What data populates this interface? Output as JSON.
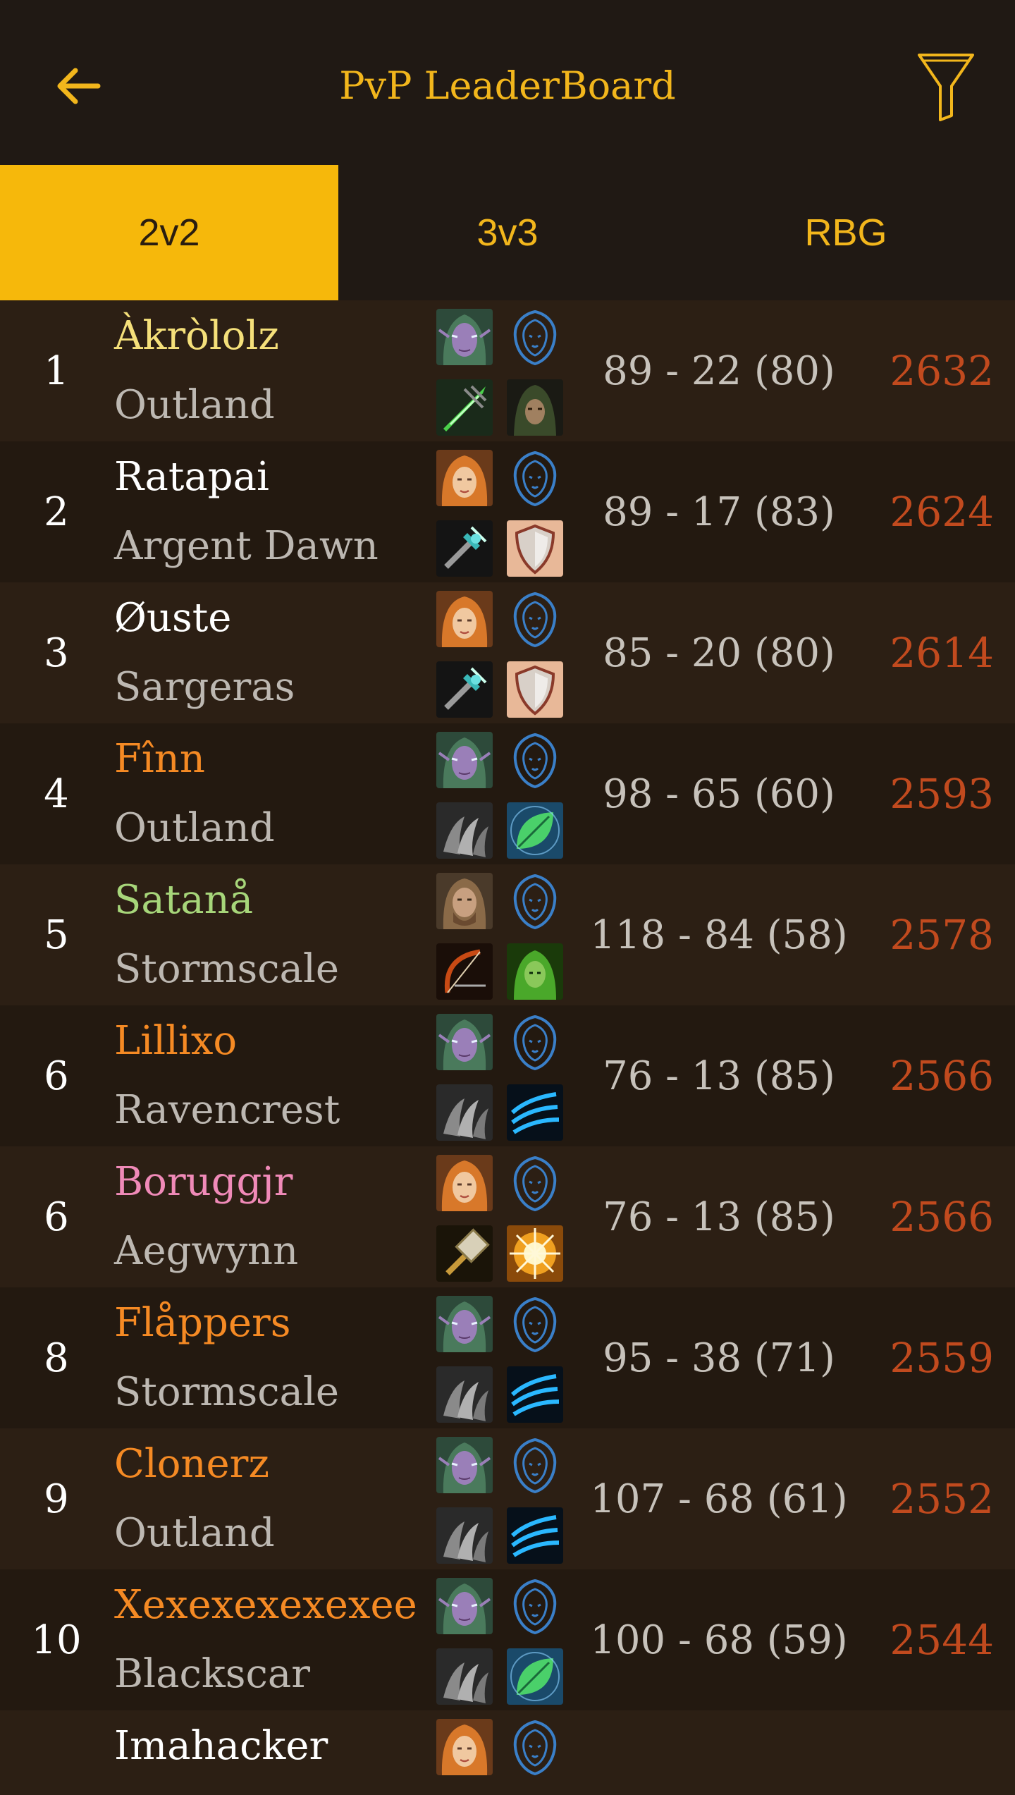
{
  "header": {
    "title": "PvP LeaderBoard",
    "back_icon": "arrow-left-icon",
    "filter_icon": "filter-icon",
    "accent": "#f2b61c"
  },
  "tabs": [
    {
      "label": "2v2",
      "active": true
    },
    {
      "label": "3v3",
      "active": false
    },
    {
      "label": "RBG",
      "active": false
    }
  ],
  "rows": [
    {
      "rank": "1",
      "name": "Àkròlolz",
      "realm": "Outland",
      "record": "89 - 22 (80)",
      "rating": "2632",
      "name_color": "#f5e07a",
      "race_icon": "night-elf-female-portrait-icon",
      "faction_icon": "alliance-lion-icon",
      "spec_icons": [
        "assassination-dagger-icon",
        "hooded-rogue-icon"
      ]
    },
    {
      "rank": "2",
      "name": "Ratapai",
      "realm": "Argent Dawn",
      "record": "89 - 17 (83)",
      "rating": "2624",
      "name_color": "#ffffff",
      "race_icon": "human-female-portrait-icon",
      "faction_icon": "alliance-lion-icon",
      "spec_icons": [
        "holy-mace-icon",
        "shield-icon"
      ]
    },
    {
      "rank": "3",
      "name": "Øuste",
      "realm": "Sargeras",
      "record": "85 - 20 (80)",
      "rating": "2614",
      "name_color": "#ffffff",
      "race_icon": "human-female-portrait-icon",
      "faction_icon": "alliance-lion-icon",
      "spec_icons": [
        "holy-mace-icon",
        "shield-icon"
      ]
    },
    {
      "rank": "4",
      "name": "Fînn",
      "realm": "Outland",
      "record": "98 - 65 (60)",
      "rating": "2593",
      "name_color": "#f58a24",
      "race_icon": "night-elf-female-portrait-icon",
      "faction_icon": "alliance-lion-icon",
      "spec_icons": [
        "bear-claw-icon",
        "green-leaf-icon"
      ]
    },
    {
      "rank": "5",
      "name": "Satanå",
      "realm": "Stormscale",
      "record": "118 - 84 (58)",
      "rating": "2578",
      "name_color": "#a7d67a",
      "race_icon": "human-male-portrait-icon",
      "faction_icon": "alliance-lion-icon",
      "spec_icons": [
        "bow-icon",
        "dryad-icon"
      ]
    },
    {
      "rank": "6",
      "name": "Lillixo",
      "realm": "Ravencrest",
      "record": "76 - 13 (85)",
      "rating": "2566",
      "name_color": "#f58a24",
      "race_icon": "night-elf-female-portrait-icon",
      "faction_icon": "alliance-lion-icon",
      "spec_icons": [
        "bear-claw-icon",
        "feral-claw-icon"
      ]
    },
    {
      "rank": "6",
      "name": "Boruggjr",
      "realm": "Aegwynn",
      "record": "76 - 13 (85)",
      "rating": "2566",
      "name_color": "#f08ab8",
      "race_icon": "human-female-portrait-icon",
      "faction_icon": "alliance-lion-icon",
      "spec_icons": [
        "hammer-icon",
        "holy-light-icon"
      ]
    },
    {
      "rank": "8",
      "name": "Flåppers",
      "realm": "Stormscale",
      "record": "95 - 38 (71)",
      "rating": "2559",
      "name_color": "#f58a24",
      "race_icon": "night-elf-female-portrait-icon",
      "faction_icon": "alliance-lion-icon",
      "spec_icons": [
        "bear-claw-icon",
        "feral-claw-icon"
      ]
    },
    {
      "rank": "9",
      "name": "Clonerz",
      "realm": "Outland",
      "record": "107 - 68 (61)",
      "rating": "2552",
      "name_color": "#f58a24",
      "race_icon": "night-elf-female-portrait-icon",
      "faction_icon": "alliance-lion-icon",
      "spec_icons": [
        "bear-claw-icon",
        "feral-claw-icon"
      ]
    },
    {
      "rank": "10",
      "name": "Xexexexexexee",
      "realm": "Blackscar",
      "record": "100 - 68 (59)",
      "rating": "2544",
      "name_color": "#f58a24",
      "race_icon": "night-elf-female-portrait-icon",
      "faction_icon": "alliance-lion-icon",
      "spec_icons": [
        "bear-claw-icon",
        "green-leaf-icon"
      ]
    }
  ],
  "partial_row": {
    "name": "Imahacker",
    "name_color": "#ffffff",
    "race_icon": "human-female-portrait-icon",
    "faction_icon": "alliance-lion-icon"
  },
  "colors": {
    "rating": "#c14a1e",
    "realm": "#bdb8b2",
    "record": "#c7c2bb"
  }
}
